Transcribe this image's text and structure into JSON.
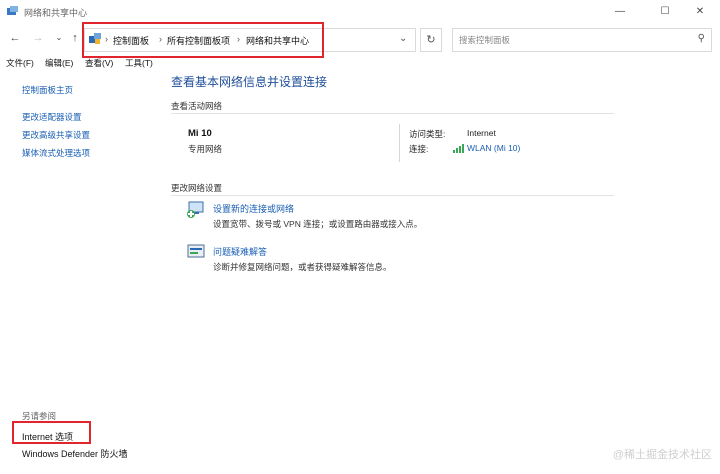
{
  "window": {
    "title": "网络和共享中心"
  },
  "address": {
    "crumbs": [
      "控制面板",
      "所有控制面板项",
      "网络和共享中心"
    ]
  },
  "search": {
    "placeholder": "搜索控制面板"
  },
  "menu": [
    "文件(F)",
    "编辑(E)",
    "查看(V)",
    "工具(T)"
  ],
  "sidebar": {
    "home": "控制面板主页",
    "items": [
      "更改适配器设置",
      "更改高级共享设置",
      "媒体流式处理选项"
    ],
    "see_also_label": "另请参阅",
    "see_also": [
      "Internet 选项",
      "Windows Defender 防火墙"
    ]
  },
  "main": {
    "heading": "查看基本网络信息并设置连接",
    "active_section": "查看活动网络",
    "network": {
      "name": "Mi 10",
      "type": "专用网络",
      "access_label": "访问类型:",
      "access_value": "Internet",
      "conn_label": "连接:",
      "conn_value": "WLAN (Mi 10)"
    },
    "change_section": "更改网络设置",
    "tasks": [
      {
        "title": "设置新的连接或网络",
        "desc": "设置宽带、拨号或 VPN 连接；或设置路由器或接入点。"
      },
      {
        "title": "问题疑难解答",
        "desc": "诊断并修复网络问题，或者获得疑难解答信息。"
      }
    ]
  },
  "watermark": "@稀土掘金技术社区",
  "colors": {
    "link": "#1a5fb4",
    "highlight": "#e0262b"
  }
}
